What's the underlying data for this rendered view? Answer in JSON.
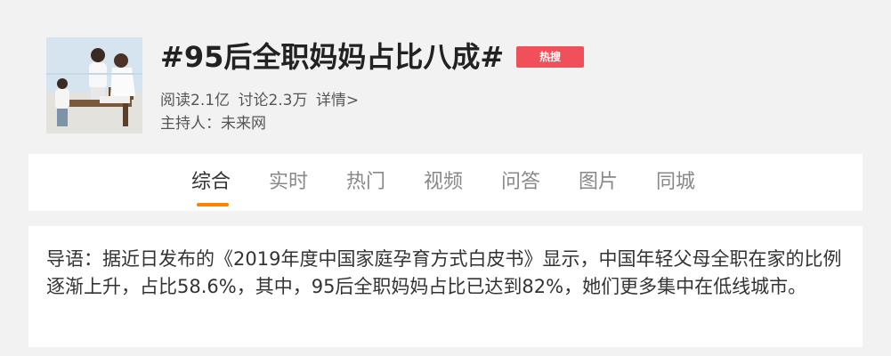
{
  "topic": {
    "title": "#95后全职妈妈占比八成#",
    "badge": "热搜",
    "stats": {
      "reads": "阅读2.1亿",
      "discussions": "讨论2.3万",
      "details": "详情>"
    },
    "host": "主持人：未来网",
    "cover_icon": "family-photo"
  },
  "tabs": [
    {
      "label": "综合",
      "active": true
    },
    {
      "label": "实时",
      "active": false
    },
    {
      "label": "热门",
      "active": false
    },
    {
      "label": "视频",
      "active": false
    },
    {
      "label": "问答",
      "active": false
    },
    {
      "label": "图片",
      "active": false
    },
    {
      "label": "同城",
      "active": false
    }
  ],
  "intro": {
    "text": "导语：据近日发布的《2019年度中国家庭孕育方式白皮书》显示，中国年轻父母全职在家的比例逐渐上升，占比58.6%，其中，95后全职妈妈占比已达到82%，她们更多集中在低线城市。"
  },
  "colors": {
    "accent": "#ff8200",
    "badge": "#f0505a",
    "background": "#f2f2f2"
  }
}
